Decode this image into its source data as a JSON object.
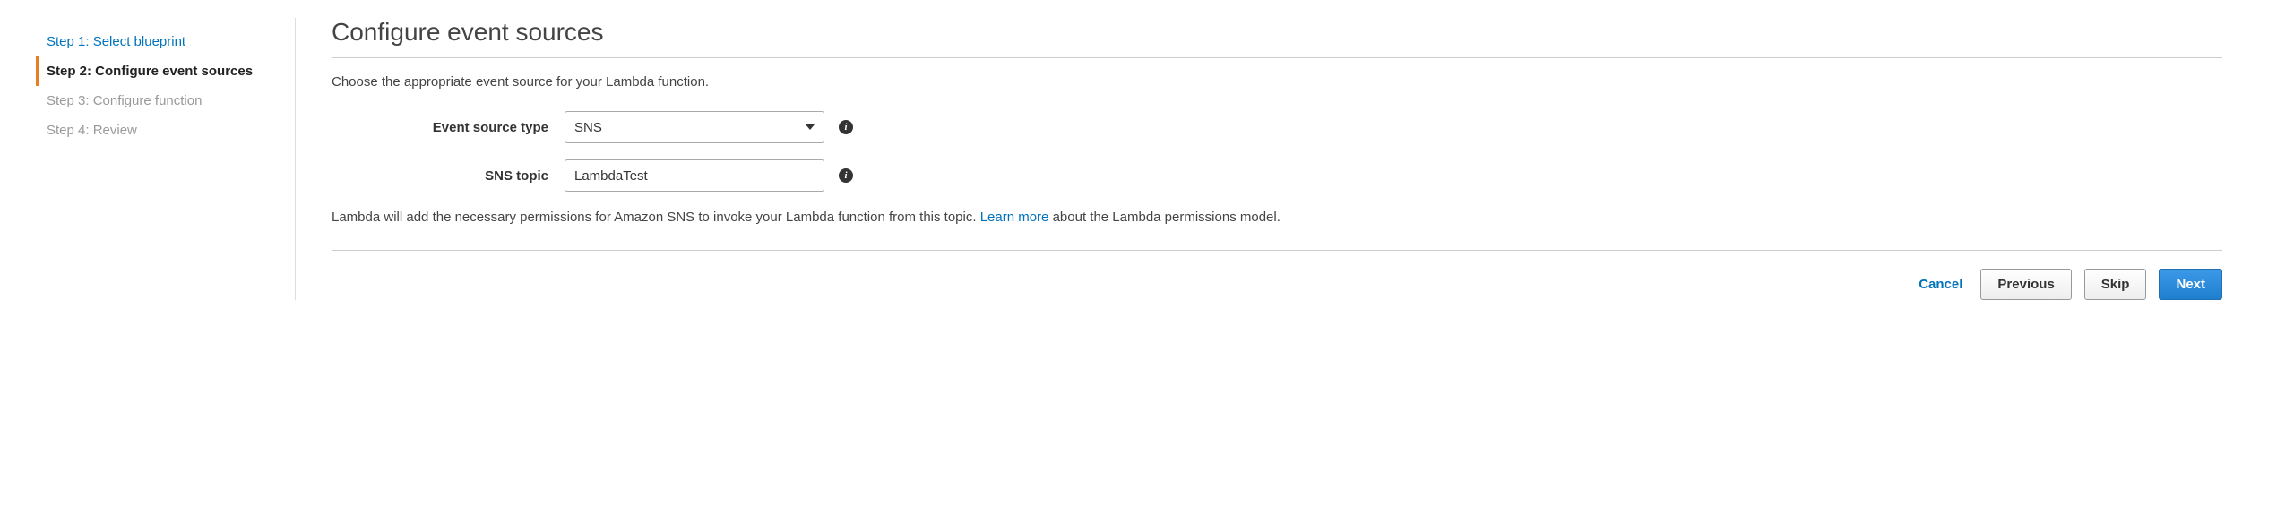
{
  "steps": [
    {
      "label": "Step 1: Select blueprint",
      "state": "link"
    },
    {
      "label": "Step 2: Configure event sources",
      "state": "active"
    },
    {
      "label": "Step 3: Configure function",
      "state": "disabled"
    },
    {
      "label": "Step 4: Review",
      "state": "disabled"
    }
  ],
  "page": {
    "title": "Configure event sources",
    "description": "Choose the appropriate event source for your Lambda function."
  },
  "form": {
    "event_source_type": {
      "label": "Event source type",
      "value": "SNS"
    },
    "sns_topic": {
      "label": "SNS topic",
      "value": "LambdaTest"
    }
  },
  "permissions": {
    "prefix": "Lambda will add the necessary permissions for Amazon SNS to invoke your Lambda function from this topic. ",
    "link": "Learn more",
    "suffix": " about the Lambda permissions model."
  },
  "footer": {
    "cancel": "Cancel",
    "previous": "Previous",
    "skip": "Skip",
    "next": "Next"
  }
}
